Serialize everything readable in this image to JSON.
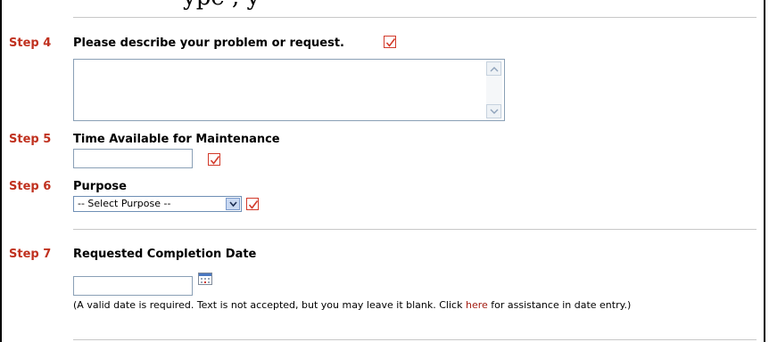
{
  "cut_heading_fragment": "ype                              ,  y",
  "step4": {
    "step": "Step 4",
    "label": "Please describe your problem or request."
  },
  "step5": {
    "step": "Step 5",
    "label": "Time Available for Maintenance",
    "value": ""
  },
  "step6": {
    "step": "Step 6",
    "label": "Purpose",
    "select_value": "-- Select Purpose --"
  },
  "step7": {
    "step": "Step 7",
    "label": "Requested Completion Date",
    "value": "",
    "help_before": "(A valid date is required. Text is not accepted, but you may leave it blank. Click ",
    "help_link": "here",
    "help_after": " for assistance in date entry.)"
  },
  "colors": {
    "step": "#c0311f",
    "required_check": "#d23a2a",
    "link": "#a21b10"
  }
}
